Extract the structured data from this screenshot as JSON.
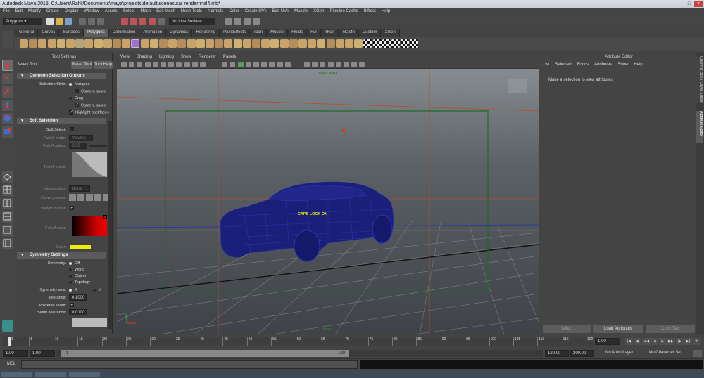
{
  "title": "Autodesk Maya 2015: C:\\Users\\Rafik\\Documents\\maya\\projects\\default\\scenes\\car renderfinal4.mb*",
  "menus": [
    "File",
    "Edit",
    "Modify",
    "Create",
    "Display",
    "Window",
    "Assets",
    "Select",
    "Mesh",
    "Edit Mesh",
    "Mesh Tools",
    "Normals",
    "Color",
    "Create UVs",
    "Edit UVs",
    "Muscle",
    "XGen",
    "Pipeline Cache",
    "Bifrost",
    "Help"
  ],
  "status": {
    "menuset": "Polygons",
    "live_surface": "No Live Surface"
  },
  "shelf_tabs": [
    "General",
    "Curves",
    "Surfaces",
    "Polygons",
    "Deformation",
    "Animation",
    "Dynamics",
    "Rendering",
    "PaintEffects",
    "Toon",
    "Muscle",
    "Fluids",
    "Fur",
    "nHair",
    "nCloth",
    "Custom",
    "XGen"
  ],
  "shelf_active": "Polygons",
  "tool_settings": {
    "header": "Tool Settings",
    "tool_name": "Select Tool",
    "reset_label": "Reset Tool",
    "help_label": "Tool Help",
    "common_selection": {
      "title": "Common Selection Options",
      "style_label": "Selection Style:",
      "marquee": "Marquee",
      "camera_based": "Camera based",
      "drag": "Drag",
      "camera_based2": "Camera based",
      "highlight_backfaces": "Highlight backfaces"
    },
    "soft_selection": {
      "title": "Soft Selection",
      "soft_select": "Soft Select:",
      "falloff_mode": "Falloff mode:",
      "falloff_mode_value": "Volume",
      "falloff_radius": "Falloff radius:",
      "falloff_radius_value": "5.00",
      "falloff_curve": "Falloff curve:",
      "interpolation": "Interpolation:",
      "interpolation_value": "None",
      "curve_presets": "Curve presets:",
      "viewport_color": "Viewport color:",
      "falloff_color": "Falloff color:",
      "color": "Color:"
    },
    "symmetry": {
      "title": "Symmetry Settings",
      "symmetry_label": "Symmetry:",
      "options": [
        "Off",
        "World",
        "Object",
        "Topology"
      ],
      "axis_label": "Symmetry axis:",
      "axis_x": "X",
      "axis_y": "Y",
      "tolerance_label": "Tolerance:",
      "tolerance_value": "0.1000",
      "preserve_seam": "Preserve seam:",
      "seam_tolerance": "Seam Tolerance:",
      "seam_tolerance_value": "0.0100"
    }
  },
  "viewport": {
    "menus": [
      "View",
      "Shading",
      "Lighting",
      "Show",
      "Renderer",
      "Panels"
    ],
    "resolution": "1920 x 1080",
    "caps_lock": "CAPS LOCK ON",
    "camera": "persp",
    "axis_y": "y",
    "axis_x": "x"
  },
  "attribute_editor": {
    "header": "Attribute Editor",
    "menus": [
      "List",
      "Selected",
      "Focus",
      "Attributes",
      "Show",
      "Help"
    ],
    "message": "Make a selection to view attributes",
    "buttons": [
      "Select",
      "Load Attributes",
      "Copy Tab"
    ]
  },
  "side_tabs": [
    "Channel Box / Layer Editor",
    "Attribute Editor"
  ],
  "timeline": {
    "ticks": [
      "1",
      "5",
      "10",
      "15",
      "20",
      "25",
      "30",
      "35",
      "40",
      "45",
      "50",
      "55",
      "60",
      "65",
      "70",
      "75",
      "80",
      "85",
      "90",
      "95",
      "100",
      "105",
      "110",
      "115",
      "120"
    ],
    "current_frame": "1.00"
  },
  "range": {
    "start": "1.00",
    "start2": "1.00",
    "slider_start": "1",
    "slider_end": "120",
    "end": "120.00",
    "end2": "200.00",
    "anim_layer": "No Anim Layer",
    "character_set": "No Character Set"
  },
  "mel_label": "MEL"
}
